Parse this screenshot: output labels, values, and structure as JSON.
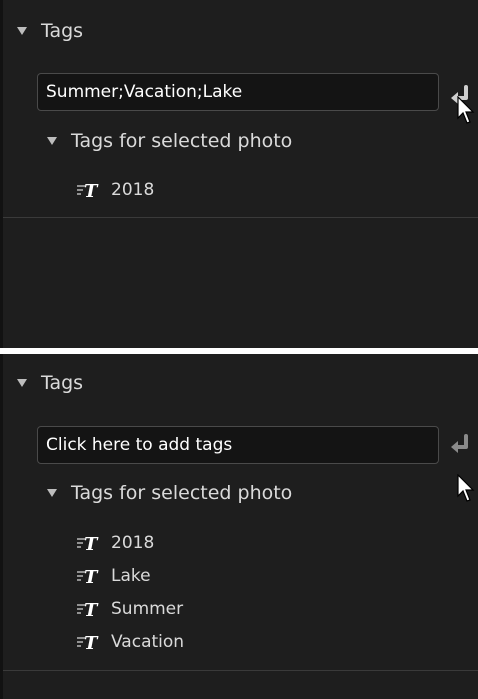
{
  "colors": {
    "panel_bg": "#1e1e1e",
    "field_bg": "#141414",
    "text": "#dadada"
  },
  "panel1": {
    "section_title": "Tags",
    "field_value": "Summer;Vacation;Lake",
    "subsection_title": "Tags for selected photo",
    "tags": [
      "2018"
    ]
  },
  "panel2": {
    "section_title": "Tags",
    "field_placeholder": "Click here to add tags",
    "subsection_title": "Tags for selected photo",
    "tags": [
      "2018",
      "Lake",
      "Summer",
      "Vacation"
    ]
  },
  "icons": {
    "caret": "caret-down-icon",
    "enter": "enter-return-icon",
    "tag": "tag-text-icon",
    "cursor": "mouse-pointer-icon"
  }
}
